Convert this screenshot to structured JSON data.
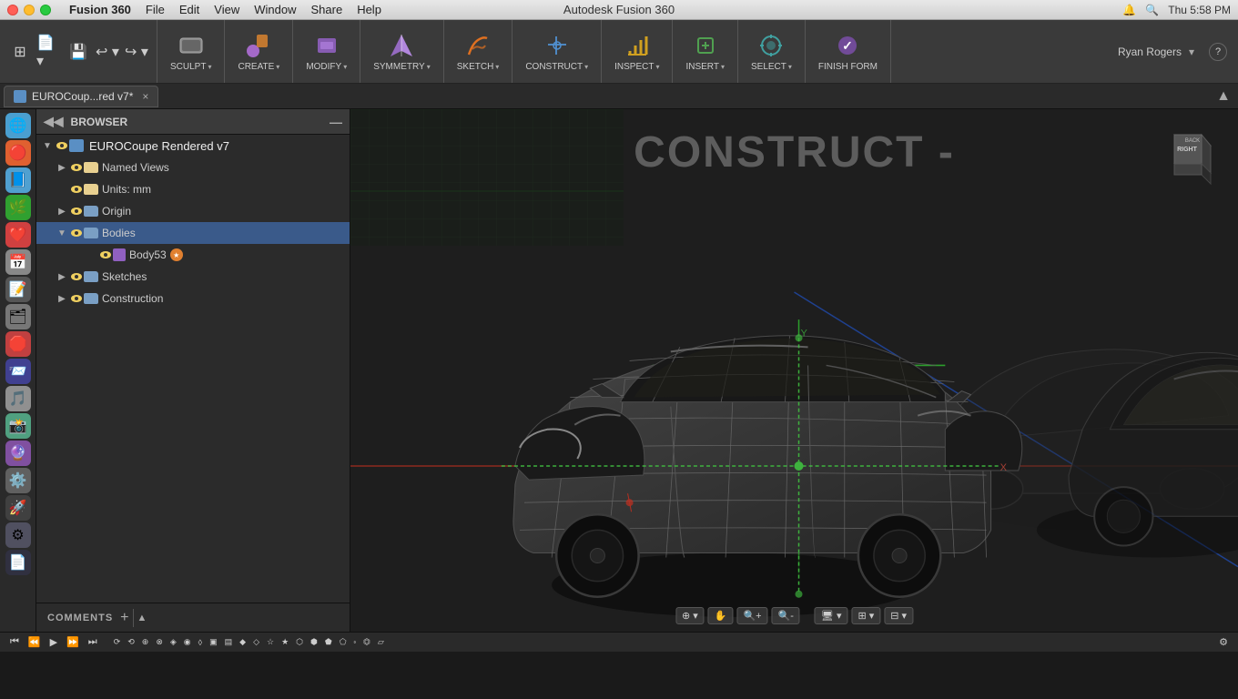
{
  "window": {
    "title": "Autodesk Fusion 360",
    "traffic_lights": [
      "close",
      "minimize",
      "maximize"
    ]
  },
  "mac_menu": {
    "app": "Fusion 360",
    "items": [
      "File",
      "Edit",
      "View",
      "Window",
      "Share",
      "Help"
    ]
  },
  "mac_topbar_right": {
    "time": "Thu 5:58 PM"
  },
  "tab": {
    "name": "EUROCoup...red  v7*",
    "close": "×"
  },
  "toolbar": {
    "sculpt_label": "SCULPT",
    "create_label": "CREATE",
    "modify_label": "MODIFY",
    "symmetry_label": "SYMMETRY",
    "sketch_label": "SKETCH",
    "construct_label": "CONSTRUCT",
    "inspect_label": "INSPECT",
    "insert_label": "INSERT",
    "select_label": "SELECT",
    "finish_label": "FINISH FORM",
    "dropdown_arrow": "▾"
  },
  "browser": {
    "header": "BROWSER",
    "root_item": "EUROCoupe Rendered  v7",
    "items": [
      {
        "label": "Named Views",
        "indent": 1,
        "type": "folder",
        "expanded": false
      },
      {
        "label": "Units: mm",
        "indent": 1,
        "type": "units",
        "expanded": false
      },
      {
        "label": "Origin",
        "indent": 1,
        "type": "folder",
        "expanded": false
      },
      {
        "label": "Bodies",
        "indent": 1,
        "type": "folder",
        "expanded": true
      },
      {
        "label": "Body53",
        "indent": 2,
        "type": "body",
        "expanded": false
      },
      {
        "label": "Sketches",
        "indent": 1,
        "type": "folder",
        "expanded": false
      },
      {
        "label": "Construction",
        "indent": 1,
        "type": "folder",
        "expanded": false
      }
    ]
  },
  "viewport": {
    "construct_label": "CONSTRUCT -",
    "grid_color": "#2a4a2a"
  },
  "view_cube": {
    "right": "RIGHT",
    "back": "BACK"
  },
  "comments": {
    "label": "COMMENTS",
    "add_icon": "+"
  },
  "user": {
    "name": "Ryan Rogers"
  }
}
